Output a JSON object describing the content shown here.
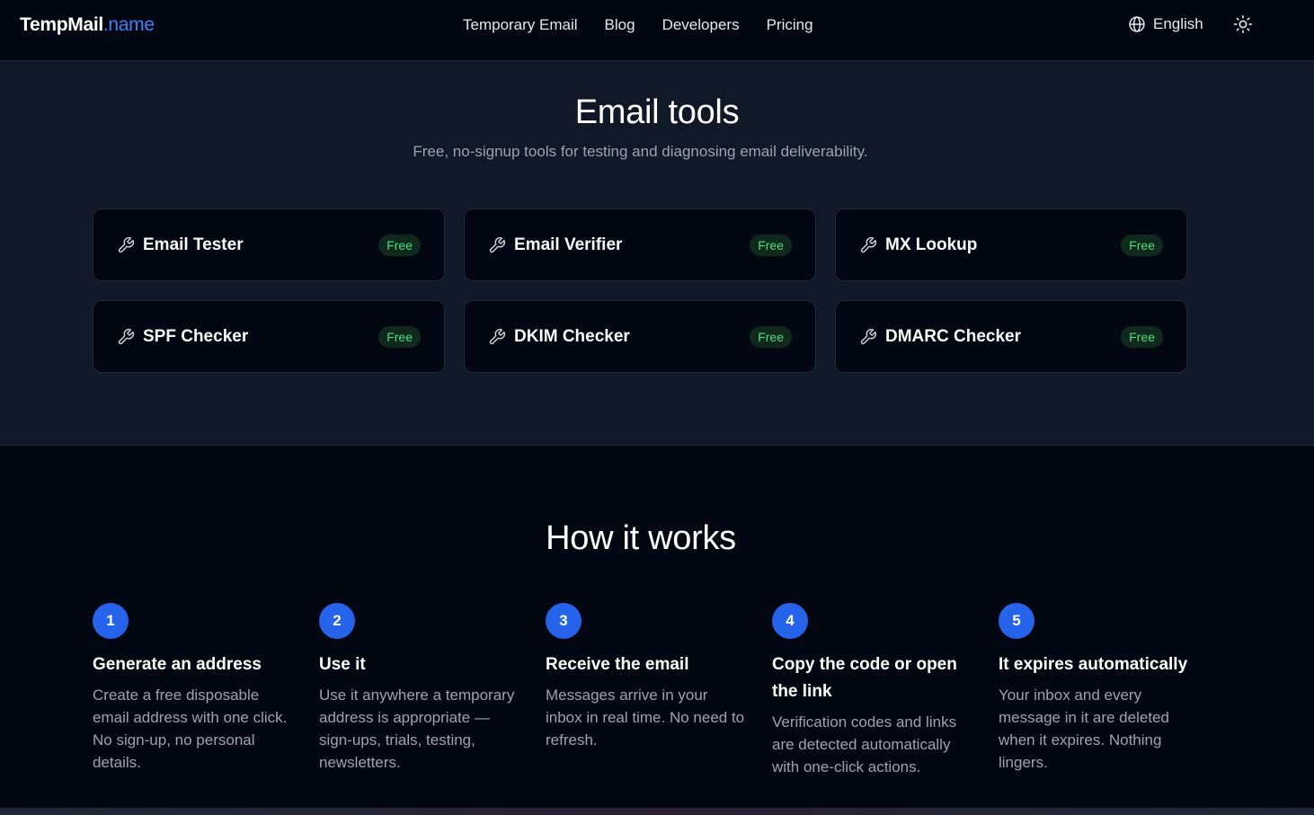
{
  "header": {
    "logo_brand": "TempMail",
    "logo_tld": ".name",
    "nav": [
      "Temporary Email",
      "Blog",
      "Developers",
      "Pricing"
    ],
    "language": "English"
  },
  "tools": {
    "title": "Email tools",
    "subtitle": "Free, no-signup tools for testing and diagnosing email deliverability.",
    "cards": [
      {
        "name": "Email Tester",
        "badge": "Free"
      },
      {
        "name": "Email Verifier",
        "badge": "Free"
      },
      {
        "name": "MX Lookup",
        "badge": "Free"
      },
      {
        "name": "SPF Checker",
        "badge": "Free"
      },
      {
        "name": "DKIM Checker",
        "badge": "Free"
      },
      {
        "name": "DMARC Checker",
        "badge": "Free"
      }
    ]
  },
  "how": {
    "title": "How it works",
    "steps": [
      {
        "num": "1",
        "title": "Generate an address",
        "desc": "Create a free disposable email address with one click. No sign-up, no personal details."
      },
      {
        "num": "2",
        "title": "Use it",
        "desc": "Use it anywhere a temporary address is appropriate — sign-ups, trials, testing, newsletters."
      },
      {
        "num": "3",
        "title": "Receive the email",
        "desc": "Messages arrive in your inbox in real time. No need to refresh."
      },
      {
        "num": "4",
        "title": "Copy the code or open the link",
        "desc": "Verification codes and links are detected automatically with one-click actions."
      },
      {
        "num": "5",
        "title": "It expires automatically",
        "desc": "Your inbox and every message in it are deleted when it expires. Nothing lingers."
      }
    ]
  },
  "colors": {
    "accent": "#2563eb",
    "logo_tld": "#3b82f6",
    "badge_text": "#4ade80"
  }
}
